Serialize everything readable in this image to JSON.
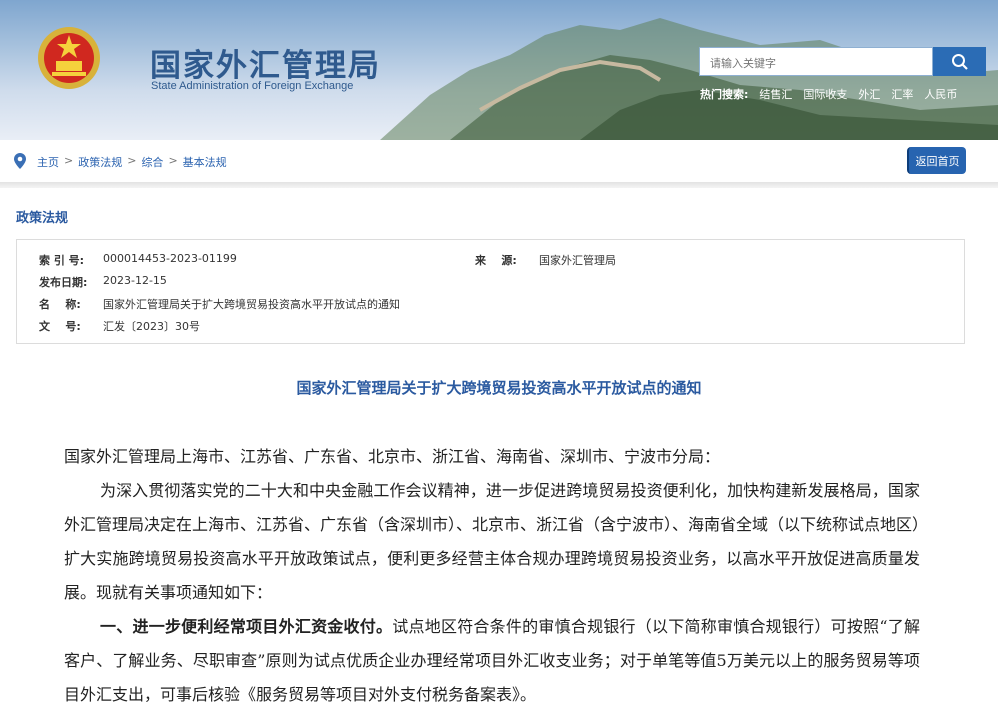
{
  "header": {
    "title": "国家外汇管理局",
    "subtitle": "State Administration of Foreign Exchange",
    "search_placeholder": "请输入关键字",
    "hot_label": "热门搜索:",
    "hot_items": [
      "结售汇",
      "国际收支",
      "外汇",
      "汇率",
      "人民币"
    ]
  },
  "breadcrumb": [
    "主页",
    "政策法规",
    "综合",
    "基本法规"
  ],
  "back_button": "返回首页",
  "section_title": "政策法规",
  "info": {
    "index_label": "索 引 号:",
    "index_value": "000014453-2023-01199",
    "source_label": "来    源:",
    "source_value": "国家外汇管理局",
    "date_label": "发布日期:",
    "date_value": "2023-12-15",
    "name_label": "名    称:",
    "name_value": "国家外汇管理局关于扩大跨境贸易投资高水平开放试点的通知",
    "doc_label": "文    号:",
    "doc_value": "汇发〔2023〕30号"
  },
  "doc_title": "国家外汇管理局关于扩大跨境贸易投资高水平开放试点的通知",
  "body": {
    "salutation": "国家外汇管理局上海市、江苏省、广东省、北京市、浙江省、海南省、深圳市、宁波市分局：",
    "para1": "为深入贯彻落实党的二十大和中央金融工作会议精神，进一步促进跨境贸易投资便利化，加快构建新发展格局，国家外汇管理局决定在上海市、江苏省、广东省（含深圳市）、北京市、浙江省（含宁波市）、海南省全域（以下统称试点地区）扩大实施跨境贸易投资高水平开放政策试点，便利更多经营主体合规办理跨境贸易投资业务，以高水平开放促进高质量发展。现就有关事项通知如下：",
    "para2_heading": "一、进一步便利经常项目外汇资金收付。",
    "para2_text": "试点地区符合条件的审慎合规银行（以下简称审慎合规银行）可按照“了解客户、了解业务、尽职审查”原则为试点优质企业办理经常项目外汇收支业务；对于单笔等值5万美元以上的服务贸易等项目外汇支出，可事后核验《服务贸易等项目对外支付税务备案表》。"
  },
  "colors": {
    "brand": "#2b5aa0",
    "button": "#2764b0"
  }
}
